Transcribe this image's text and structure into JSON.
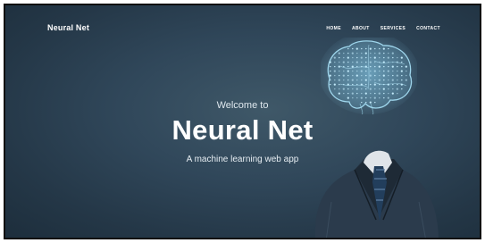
{
  "header": {
    "brand": "Neural Net",
    "nav": [
      "HOME",
      "ABOUT",
      "SERVICES",
      "CONTACT"
    ]
  },
  "hero": {
    "welcome": "Welcome to",
    "title": "Neural Net",
    "tagline": "A machine learning web app"
  },
  "colors": {
    "background": "#2d4455",
    "brain_glow": "#8fd3f0",
    "text": "#ffffff"
  },
  "icons": {
    "brain": "digital-brain-illustration",
    "figure": "business-suit-figure"
  }
}
